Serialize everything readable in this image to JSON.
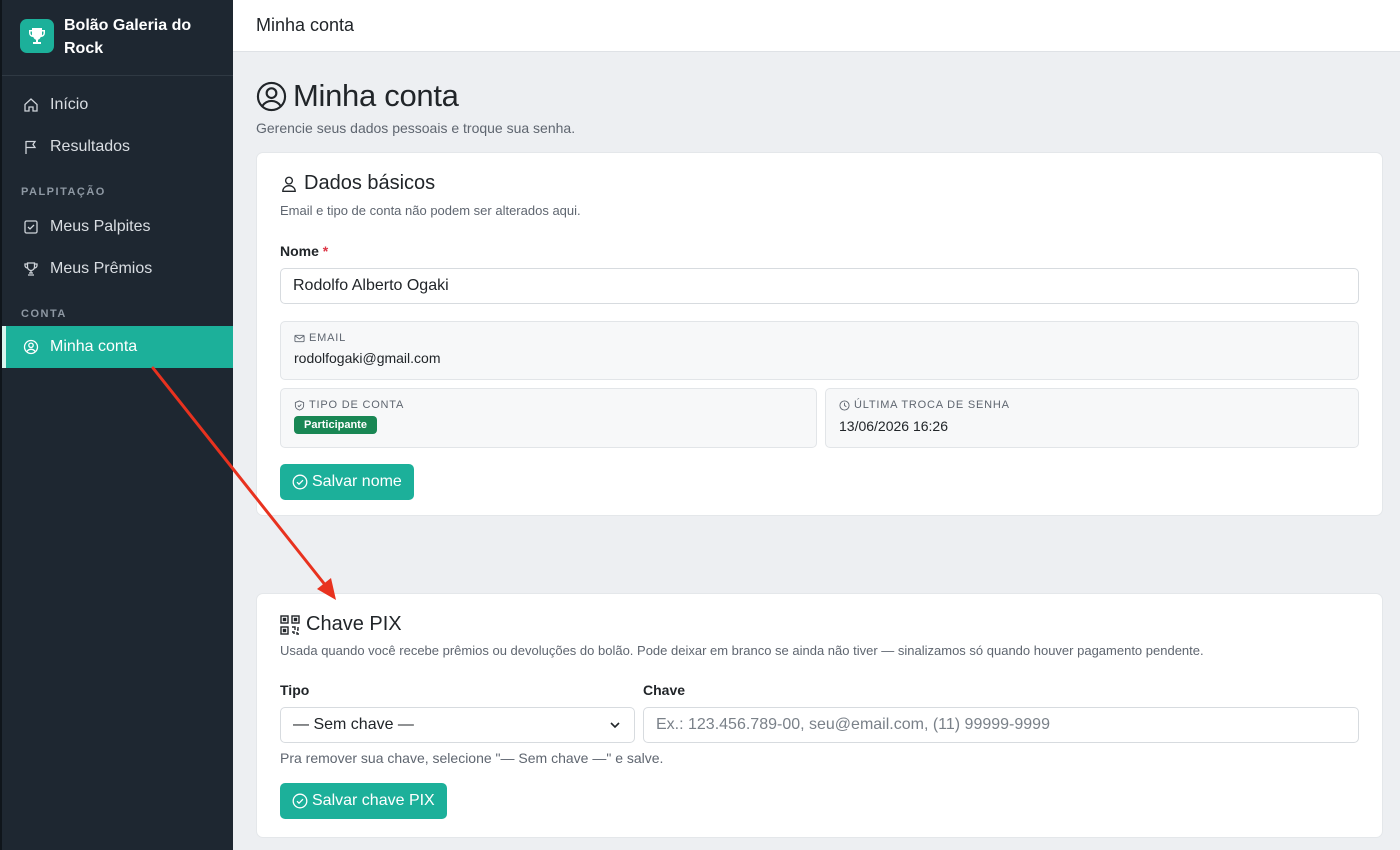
{
  "brand": {
    "title": "Bolão Galeria do Rock",
    "icon": "trophy-icon"
  },
  "sidebar": {
    "items_top": [
      {
        "label": "Início",
        "icon": "home-icon"
      },
      {
        "label": "Resultados",
        "icon": "flag-icon"
      }
    ],
    "section_palpitacao": "PALPITAÇÃO",
    "items_palpitacao": [
      {
        "label": "Meus Palpites",
        "icon": "check-square-icon"
      },
      {
        "label": "Meus Prêmios",
        "icon": "trophy-icon"
      }
    ],
    "section_conta": "CONTA",
    "items_conta": [
      {
        "label": "Minha conta",
        "icon": "user-circle-icon",
        "active": true
      }
    ]
  },
  "topbar": {
    "title": "Minha conta"
  },
  "page": {
    "title": "Minha conta",
    "subtitle": "Gerencie seus dados pessoais e troque sua senha."
  },
  "dados": {
    "title": "Dados básicos",
    "description": "Email e tipo de conta não podem ser alterados aqui.",
    "nome_label": "Nome",
    "required_mark": "*",
    "nome_value": "Rodolfo Alberto Ogaki",
    "email_label": "EMAIL",
    "email_value": "rodolfogaki@gmail.com",
    "tipo_label": "TIPO DE CONTA",
    "tipo_value": "Participante",
    "senha_label": "ÚLTIMA TROCA DE SENHA",
    "senha_value": "13/06/2026 16:26",
    "save_label": "Salvar nome"
  },
  "pix": {
    "title": "Chave PIX",
    "description": "Usada quando você recebe prêmios ou devoluções do bolão. Pode deixar em branco se ainda não tiver — sinalizamos só quando houver pagamento pendente.",
    "tipo_label": "Tipo",
    "tipo_selected": "— Sem chave —",
    "chave_label": "Chave",
    "chave_placeholder": "Ex.: 123.456.789-00, seu@email.com, (11) 99999-9999",
    "help": "Pra remover sua chave, selecione \"— Sem chave —\" e salve.",
    "save_label": "Salvar chave PIX"
  },
  "colors": {
    "accent": "#1cb09a",
    "sidebar": "#1e2731",
    "badge": "#198754",
    "annotation_arrow": "#e8321f"
  }
}
